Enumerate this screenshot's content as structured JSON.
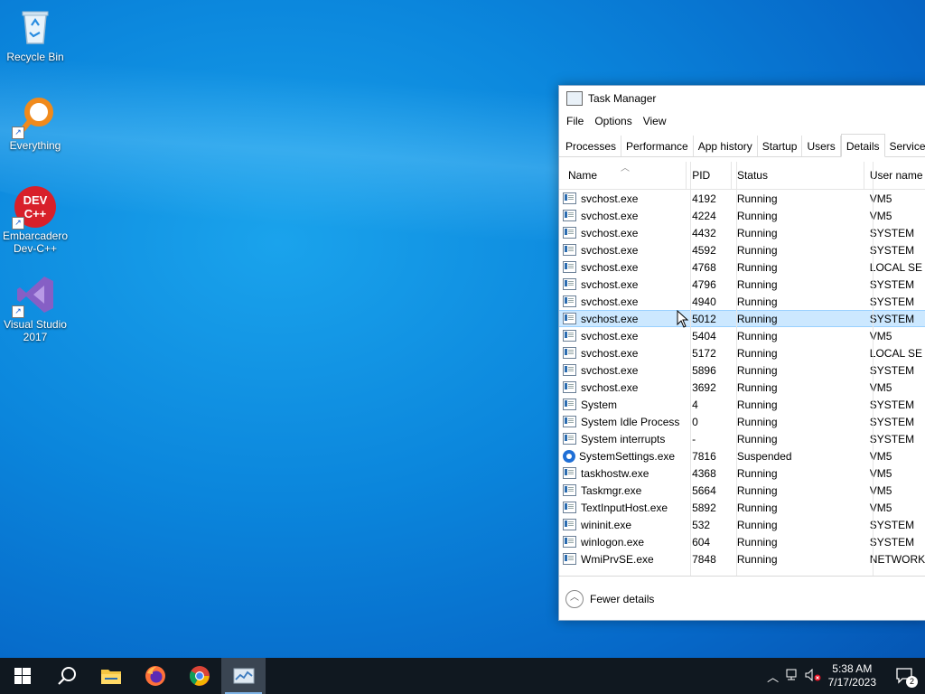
{
  "desktop": {
    "icons": [
      {
        "label": "Recycle Bin",
        "icon": "recycle-bin-icon"
      },
      {
        "label": "Everything",
        "icon": "magnifier-icon"
      },
      {
        "label": "Embarcadero Dev-C++",
        "line1": "Embarcadero",
        "line2": "Dev-C++",
        "badge": "DEV C++",
        "icon": "devcpp-icon"
      },
      {
        "label": "Visual Studio 2017",
        "line1": "Visual Studio",
        "line2": "2017",
        "icon": "visual-studio-icon"
      }
    ]
  },
  "task_manager": {
    "title": "Task Manager",
    "menu": [
      "File",
      "Options",
      "View"
    ],
    "tabs": [
      "Processes",
      "Performance",
      "App history",
      "Startup",
      "Users",
      "Details",
      "Services"
    ],
    "active_tab": "Details",
    "columns": {
      "name": "Name",
      "pid": "PID",
      "status": "Status",
      "user": "User name"
    },
    "rows": [
      {
        "name": "svchost.exe",
        "pid": "4192",
        "status": "Running",
        "user": "VM5"
      },
      {
        "name": "svchost.exe",
        "pid": "4224",
        "status": "Running",
        "user": "VM5"
      },
      {
        "name": "svchost.exe",
        "pid": "4432",
        "status": "Running",
        "user": "SYSTEM"
      },
      {
        "name": "svchost.exe",
        "pid": "4592",
        "status": "Running",
        "user": "SYSTEM"
      },
      {
        "name": "svchost.exe",
        "pid": "4768",
        "status": "Running",
        "user": "LOCAL SE"
      },
      {
        "name": "svchost.exe",
        "pid": "4796",
        "status": "Running",
        "user": "SYSTEM"
      },
      {
        "name": "svchost.exe",
        "pid": "4940",
        "status": "Running",
        "user": "SYSTEM"
      },
      {
        "name": "svchost.exe",
        "pid": "5012",
        "status": "Running",
        "user": "SYSTEM",
        "selected": true
      },
      {
        "name": "svchost.exe",
        "pid": "5404",
        "status": "Running",
        "user": "VM5"
      },
      {
        "name": "svchost.exe",
        "pid": "5172",
        "status": "Running",
        "user": "LOCAL SE"
      },
      {
        "name": "svchost.exe",
        "pid": "5896",
        "status": "Running",
        "user": "SYSTEM"
      },
      {
        "name": "svchost.exe",
        "pid": "3692",
        "status": "Running",
        "user": "VM5"
      },
      {
        "name": "System",
        "pid": "4",
        "status": "Running",
        "user": "SYSTEM"
      },
      {
        "name": "System Idle Process",
        "pid": "0",
        "status": "Running",
        "user": "SYSTEM"
      },
      {
        "name": "System interrupts",
        "pid": "-",
        "status": "Running",
        "user": "SYSTEM"
      },
      {
        "name": "SystemSettings.exe",
        "pid": "7816",
        "status": "Suspended",
        "user": "VM5",
        "icon": "gear"
      },
      {
        "name": "taskhostw.exe",
        "pid": "4368",
        "status": "Running",
        "user": "VM5"
      },
      {
        "name": "Taskmgr.exe",
        "pid": "5664",
        "status": "Running",
        "user": "VM5"
      },
      {
        "name": "TextInputHost.exe",
        "pid": "5892",
        "status": "Running",
        "user": "VM5"
      },
      {
        "name": "wininit.exe",
        "pid": "532",
        "status": "Running",
        "user": "SYSTEM"
      },
      {
        "name": "winlogon.exe",
        "pid": "604",
        "status": "Running",
        "user": "SYSTEM"
      },
      {
        "name": "WmiPrvSE.exe",
        "pid": "7848",
        "status": "Running",
        "user": "NETWORK"
      }
    ],
    "footer_label": "Fewer details"
  },
  "taskbar": {
    "items": [
      "start-button",
      "search-button",
      "file-explorer",
      "firefox",
      "chrome",
      "task-manager"
    ],
    "active_item": "task-manager",
    "clock_time": "5:38 AM",
    "clock_date": "7/17/2023",
    "notification_count": "2"
  },
  "colors": {
    "selection": "#cce8ff",
    "taskbar": "#101820",
    "accent": "#0078d7"
  }
}
